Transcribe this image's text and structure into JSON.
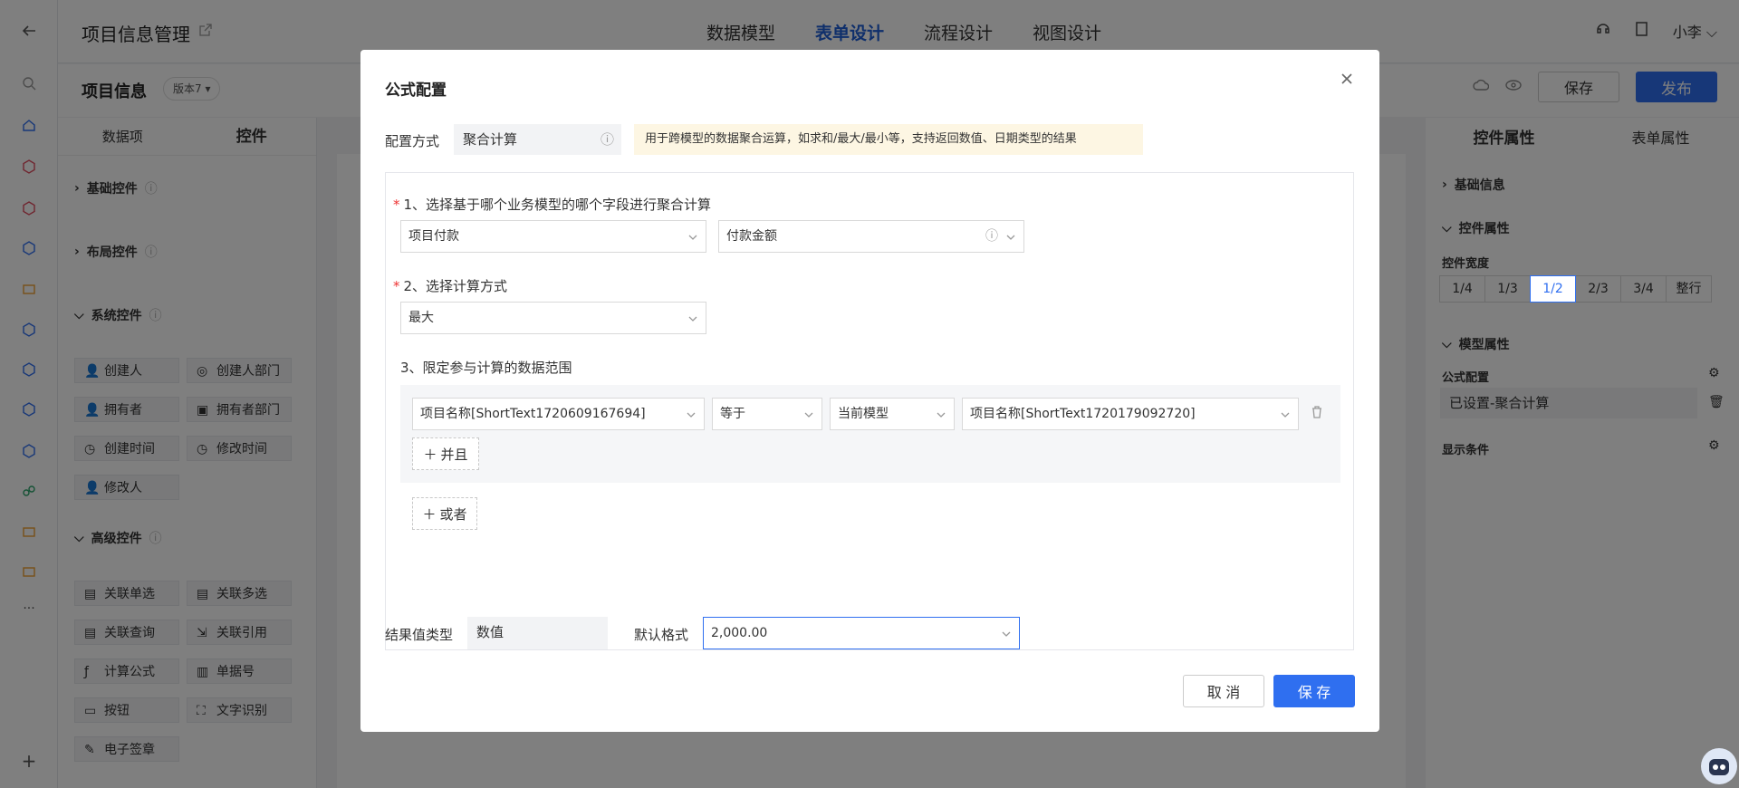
{
  "header": {
    "title": "项目信息管理",
    "tabs": [
      {
        "label": "数据模型"
      },
      {
        "label": "表单设计",
        "active": true
      },
      {
        "label": "流程设计"
      },
      {
        "label": "视图设计"
      }
    ],
    "user": "小李"
  },
  "toolbar": {
    "form_title": "项目信息",
    "version": "版本7",
    "save_label": "保存",
    "publish_label": "发布"
  },
  "left_panel": {
    "tabs": [
      "数据项",
      "控件"
    ],
    "groups": {
      "basic": "基础控件",
      "layout": "布局控件",
      "system": "系统控件",
      "advanced": "高级控件"
    },
    "system_items": [
      "创建人",
      "创建人部门",
      "拥有者",
      "拥有者部门",
      "创建时间",
      "修改时间",
      "修改人"
    ],
    "advanced_items": [
      "关联单选",
      "关联多选",
      "关联查询",
      "关联引用",
      "计算公式",
      "单据号",
      "按钮",
      "文字识别",
      "电子签章"
    ]
  },
  "right_panel": {
    "tabs": [
      "控件属性",
      "表单属性"
    ],
    "basic_info": "基础信息",
    "control_props": "控件属性",
    "width_label": "控件宽度",
    "widths": [
      "1/4",
      "1/3",
      "1/2",
      "2/3",
      "3/4",
      "整行"
    ],
    "selected_width": "1/2",
    "model_props": "模型属性",
    "formula_label": "公式配置",
    "formula_value": "已设置-聚合计算",
    "display_cond": "显示条件"
  },
  "modal": {
    "title": "公式配置",
    "config_mode_label": "配置方式",
    "config_mode_value": "聚合计算",
    "hint": "用于跨模型的数据聚合运算，如求和/最大/最小等，支持返回数值、日期类型的结果",
    "step1": "1、选择基于哪个业务模型的哪个字段进行聚合计算",
    "model_select": "项目付款",
    "field_select": "付款金额",
    "step2": "2、选择计算方式",
    "calc_select": "最大",
    "step3": "3、限定参与计算的数据范围",
    "filter": {
      "field": "项目名称[ShortText1720609167694]",
      "operator": "等于",
      "source": "当前模型",
      "target": "项目名称[ShortText1720179092720]"
    },
    "and_label": "并且",
    "or_label": "或者",
    "result_type_label": "结果值类型",
    "result_type_value": "数值",
    "default_format_label": "默认格式",
    "default_format_value": "2,000.00",
    "cancel_label": "取 消",
    "save_label": "保 存"
  },
  "colors": {
    "primary": "#2f6ff0",
    "hint_bg": "#fdf6e3",
    "required": "#e33333"
  }
}
